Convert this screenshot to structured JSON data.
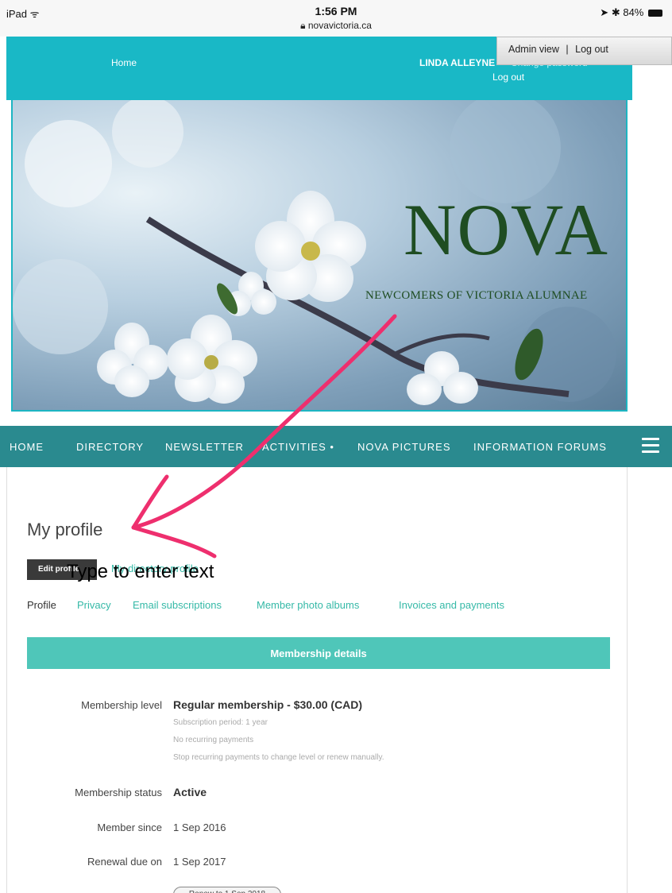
{
  "status_bar": {
    "device": "iPad",
    "wifi": "ᯤ",
    "time": "1:56 PM",
    "url": "novavictoria.ca",
    "battery": "84%"
  },
  "admin_popup": {
    "admin_view": "Admin view",
    "separator": "|",
    "log_out": "Log out"
  },
  "header": {
    "home": "Home",
    "user_name": "LINDA ALLEYNE",
    "change_password": "Change password",
    "log_out": "Log out"
  },
  "banner": {
    "title": "NOVA",
    "subtitle": "NEWCOMERS OF VICTORIA ALUMNAE"
  },
  "nav": {
    "items": [
      "HOME",
      "DIRECTORY",
      "NEWSLETTER",
      "ACTIVITIES •",
      "NOVA PICTURES",
      "INFORMATION FORUMS"
    ],
    "menu_icon": "hamburger-icon"
  },
  "profile": {
    "title": "My profile",
    "edit_button": "Edit profile",
    "directory_link": "My directory profile",
    "annotation_text": "Type to enter text",
    "tabs": [
      "Profile",
      "Privacy",
      "Email subscriptions",
      "Member photo albums",
      "Invoices and payments"
    ],
    "section_title": "Membership details",
    "level_label": "Membership level",
    "level_value": "Regular membership - $30.00 (CAD)",
    "note_period": "Subscription period: 1 year",
    "note_recurring": "No recurring payments",
    "note_stop": "Stop recurring payments to change level or renew manually.",
    "status_label": "Membership status",
    "status_value": "Active",
    "since_label": "Member since",
    "since_value": "1 Sep 2016",
    "renewal_label": "Renewal due on",
    "renewal_value": "1 Sep 2017",
    "renew_button": "Renew to 1 Sep 2018"
  },
  "colors": {
    "header_teal": "#19b8c6",
    "nav_teal": "#2a8a8f",
    "section_teal": "#4fc6b9",
    "link_teal": "#35b9a7",
    "annotation_pink": "#ee2f6e"
  }
}
